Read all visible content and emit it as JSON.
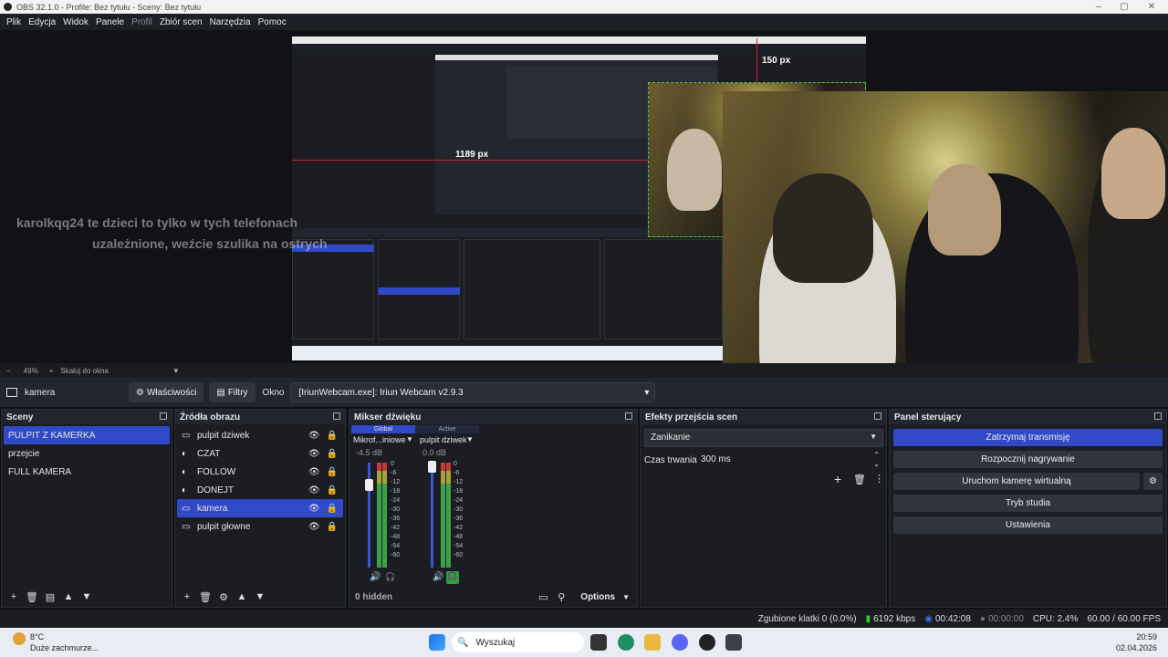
{
  "window": {
    "title": "OBS 32.1.0 - Profile: Bez tytułu - Sceny: Bez tytułu"
  },
  "menu": [
    {
      "label": "Plik",
      "enabled": true
    },
    {
      "label": "Edycja",
      "enabled": true
    },
    {
      "label": "Widok",
      "enabled": true
    },
    {
      "label": "Panele",
      "enabled": true
    },
    {
      "label": "Profil",
      "enabled": false
    },
    {
      "label": "Zbiór scen",
      "enabled": true
    },
    {
      "label": "Narzędzia",
      "enabled": true
    },
    {
      "label": "Pomoc",
      "enabled": true
    }
  ],
  "preview": {
    "chat_line1": "karolkqq24  te dzieci to tylko w tych telefonach",
    "chat_line2": "uzależnione, weźcie szulika na ostrych",
    "guide_top_label": "150 px",
    "guide_left_label": "1189 px"
  },
  "zoom": {
    "value": "49%",
    "scale_label": "Skaluj do okna"
  },
  "source_toolbar": {
    "source_name": "kamera",
    "properties_label": "Właściwości",
    "filters_label": "Filtry",
    "window_label": "Okno",
    "window_value": "[IriunWebcam.exe]: Iriun Webcam v2.9.3"
  },
  "scenes": {
    "title": "Sceny",
    "items": [
      "PULPIT Z KAMERKA",
      "przejcie",
      "FULL KAMERA"
    ],
    "selected": 0
  },
  "sources": {
    "title": "Źródła obrazu",
    "items": [
      {
        "name": "pulpit dziwek",
        "icon": "display-icon"
      },
      {
        "name": "CZAT",
        "icon": "browser-icon"
      },
      {
        "name": "FOLLOW",
        "icon": "browser-icon"
      },
      {
        "name": "DONEJT",
        "icon": "browser-icon"
      },
      {
        "name": "kamera",
        "icon": "window-icon"
      },
      {
        "name": "pulpit głowne",
        "icon": "monitor-icon"
      }
    ],
    "selected": 4
  },
  "mixer": {
    "title": "Mikser dźwięku",
    "tab_global": "Global",
    "tab_active": "Active",
    "ch1_name": "Mikrof...iniowe",
    "ch1_db": "-4.5 dB",
    "ch2_name": "pulpit dziwek",
    "ch2_db": "0.0 dB",
    "scale": [
      "0",
      "-6",
      "-12",
      "-18",
      "-24",
      "-30",
      "-36",
      "-42",
      "-48",
      "-54",
      "-60"
    ],
    "hidden": "0 hidden",
    "options": "Options"
  },
  "transitions": {
    "title": "Efekty przejścia scen",
    "type": "Zanikanie",
    "duration_label": "Czas trwania",
    "duration_value": "300 ms"
  },
  "controls": {
    "title": "Panel sterujący",
    "buttons": [
      "Zatrzymaj transmisję",
      "Rozpocznij nagrywanie",
      "Uruchom kamerę wirtualną",
      "Tryb studia",
      "Ustawienia"
    ]
  },
  "status": {
    "dropped": "Zgubione klatki 0 (0.0%)",
    "bitrate": "6192 kbps",
    "stream_time": "00:42:08",
    "rec_time": "00:00:00",
    "cpu": "CPU: 2.4%",
    "fps": "60.00 / 60.00 FPS"
  },
  "taskbar": {
    "temp": "8°C",
    "weather": "Duże zachmurze...",
    "search": "Wyszukaj",
    "time": "20:59",
    "date": "02.04.2026"
  },
  "colors": {
    "accent": "#2f49c7",
    "guide": "#d2202a"
  }
}
